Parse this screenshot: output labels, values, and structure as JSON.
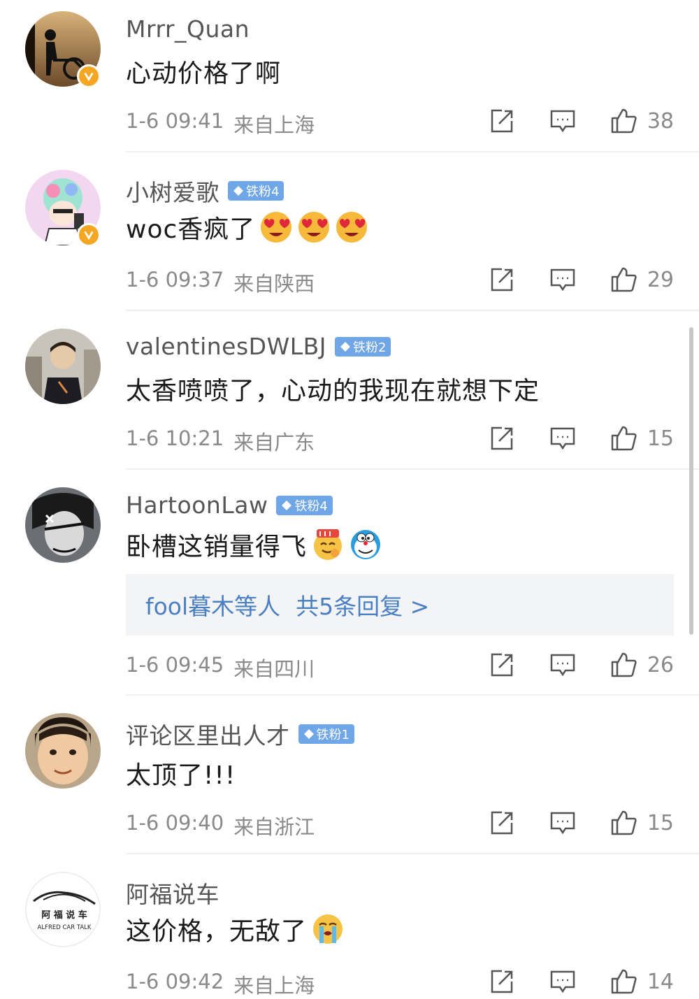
{
  "comments": [
    {
      "username": "Mrrr_Quan",
      "verified": true,
      "badge": "",
      "text": "心动价格了啊",
      "emojis": [],
      "date": "1-6 09:41",
      "location": "来自上海",
      "likes": "38"
    },
    {
      "username": "小树爱歌",
      "verified": true,
      "badge": "铁粉4",
      "text": "woc香疯了",
      "emojis": [
        "heart-eyes-emoji",
        "heart-eyes-emoji",
        "heart-eyes-emoji"
      ],
      "date": "1-6 09:37",
      "location": "来自陕西",
      "likes": "29"
    },
    {
      "username": "valentinesDWLBJ",
      "verified": false,
      "badge": "铁粉2",
      "text": "太香喷喷了，心动的我现在就想下定",
      "emojis": [],
      "date": "1-6 10:21",
      "location": "来自广东",
      "likes": "15"
    },
    {
      "username": "HartoonLaw",
      "verified": false,
      "badge": "铁粉4",
      "text": "卧槽这销量得飞",
      "emojis": [
        "666-emoji",
        "doraemon-emoji"
      ],
      "replies": {
        "who": "fool暮木等人",
        "count_text": "共5条回复 >"
      },
      "date": "1-6 09:45",
      "location": "来自四川",
      "likes": "26"
    },
    {
      "username": "评论区里出人才",
      "verified": false,
      "badge": "铁粉1",
      "text": "太顶了!!!",
      "emojis": [],
      "date": "1-6 09:40",
      "location": "来自浙江",
      "likes": "15"
    },
    {
      "username": "阿福说车",
      "verified": false,
      "badge": "",
      "avatar_text": [
        "阿 福 说 车",
        "ALFRED CAR TALK"
      ],
      "text": "这价格，无敌了",
      "emojis": [
        "crying-emoji"
      ],
      "date": "1-6 09:42",
      "location": "来自上海",
      "likes": "14"
    }
  ],
  "icons": {
    "share": "share-icon",
    "reply": "comment-icon",
    "like": "thumbs-up-icon",
    "verified": "verified-v-icon",
    "badge": "diamond-icon"
  },
  "colors": {
    "verified": "#f5a623",
    "badge": "#6fa6e8",
    "reply_link": "#4a7fc4",
    "meta": "#8a8a8a"
  }
}
